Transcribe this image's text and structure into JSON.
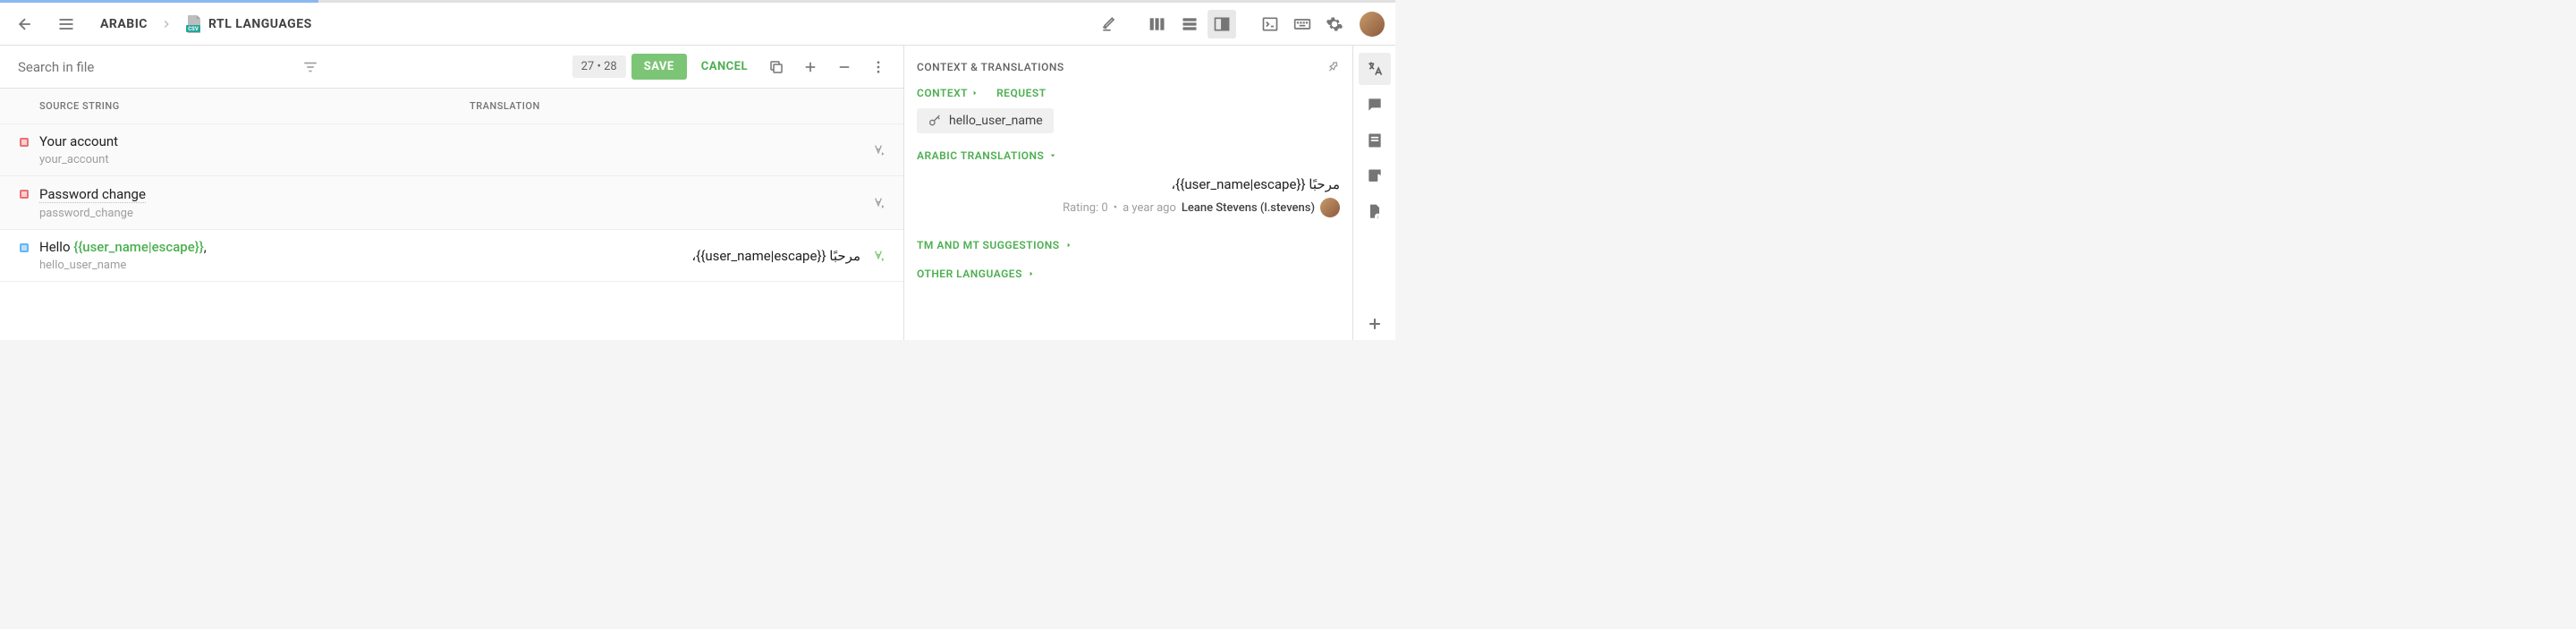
{
  "breadcrumb": {
    "lang": "ARABIC",
    "file": "RTL LANGUAGES"
  },
  "search": {
    "placeholder": "Search in file"
  },
  "toolbar": {
    "counter": "27  •  28",
    "save": "SAVE",
    "cancel": "CANCEL"
  },
  "columns": {
    "source": "SOURCE STRING",
    "translation": "TRANSLATION"
  },
  "rows": [
    {
      "status": "red",
      "source": "Your account",
      "key": "your_account",
      "translation": ""
    },
    {
      "status": "red",
      "source": "Password change",
      "key": "password_change",
      "translation": ""
    },
    {
      "status": "blue",
      "source_prefix": "Hello ",
      "source_token": "{{user_name|escape}}",
      "source_suffix": ",",
      "key": "hello_user_name",
      "translation": "مرحبًا {{user_name|escape}}،"
    }
  ],
  "side": {
    "title": "CONTEXT & TRANSLATIONS",
    "tab_context": "CONTEXT",
    "tab_request": "REQUEST",
    "key": "hello_user_name",
    "section_translations": "ARABIC TRANSLATIONS",
    "translation_value": "مرحبًا {{user_name|escape}}،",
    "rating": "Rating: 0",
    "time": "a year ago",
    "author": "Leane Stevens (l.stevens)",
    "section_tm": "TM AND MT SUGGESTIONS",
    "section_other": "OTHER LANGUAGES"
  }
}
